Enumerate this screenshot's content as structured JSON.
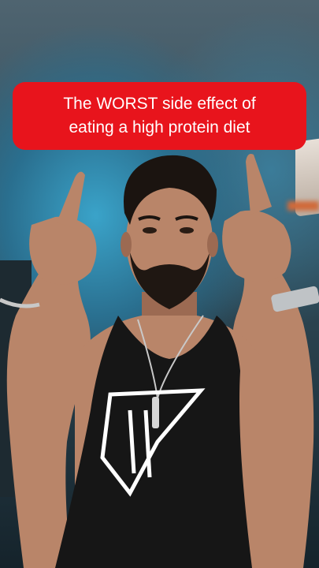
{
  "caption": {
    "line1": "The WORST side effect of",
    "line2": "eating a high protein diet"
  },
  "colors": {
    "caption_bg": "#e8141c",
    "caption_text": "#ffffff",
    "backdrop_glow": "#3aa3c9"
  },
  "figure": {
    "description_icon": "person-pointing-up-icon",
    "shirt_graphic": "shirt-logo-icon"
  }
}
